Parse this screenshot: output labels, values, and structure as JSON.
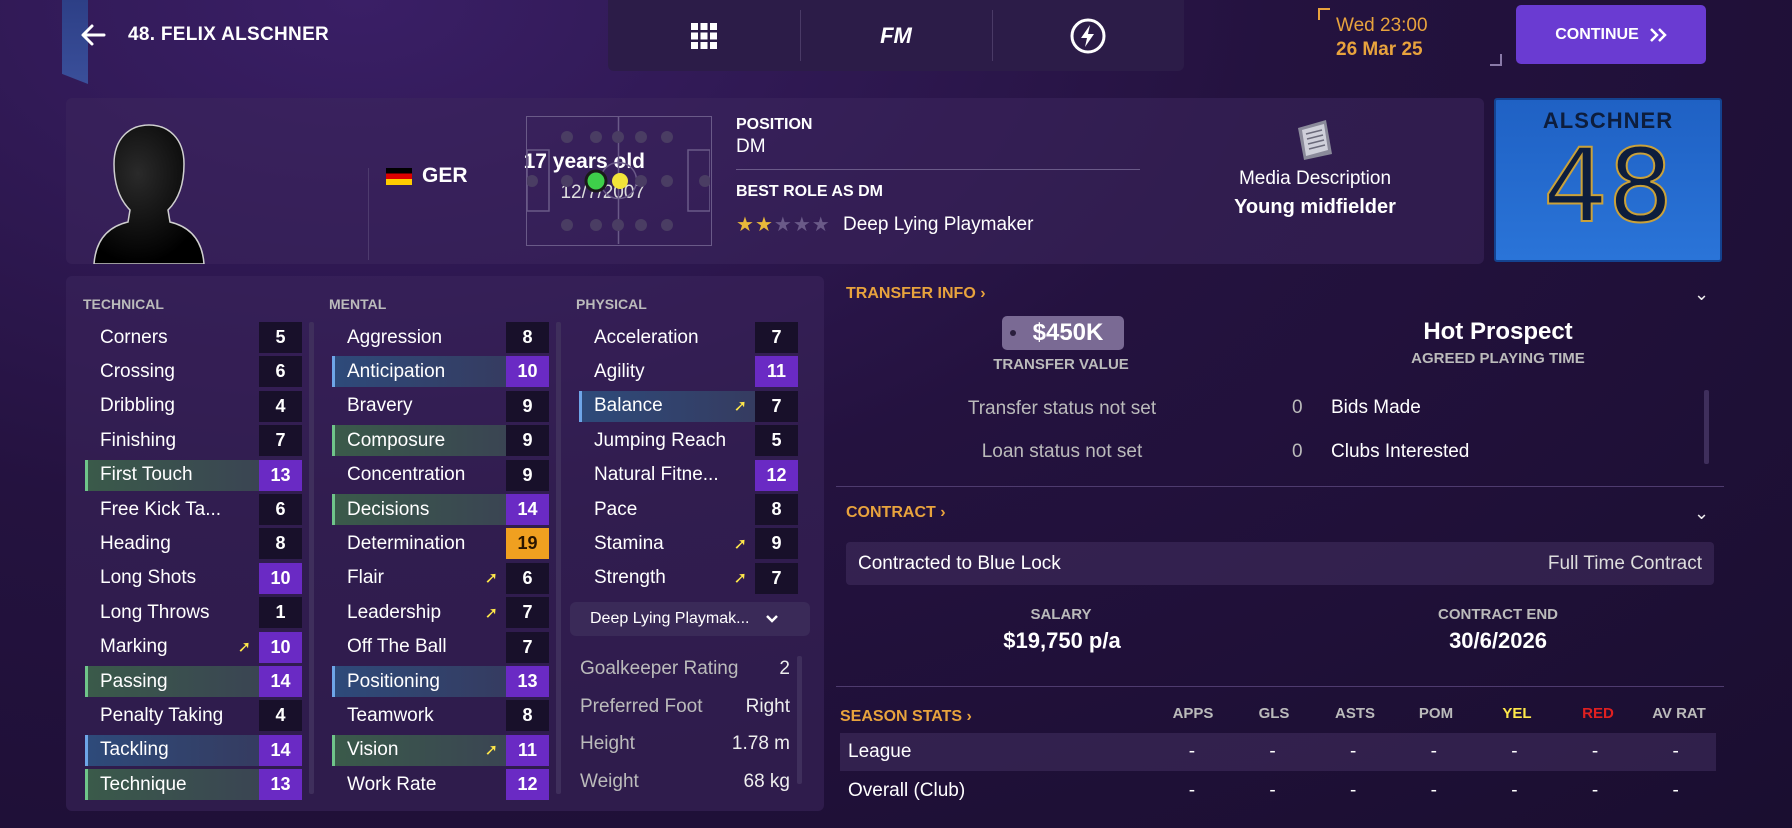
{
  "header": {
    "title": "48. FELIX ALSCHNER",
    "nav_fm": "FM",
    "date_line1": "Wed 23:00",
    "date_line2": "26 Mar 25",
    "continue_label": "CONTINUE"
  },
  "profile": {
    "age": "17 years old",
    "dob": "12/7/2007",
    "nationality": "GER",
    "position_label": "POSITION",
    "position": "DM",
    "best_role_label": "BEST ROLE AS DM",
    "best_role": "Deep Lying Playmaker",
    "role_stars": 2,
    "media_label": "Media Description",
    "media_value": "Young midfielder",
    "shirt_name": "ALSCHNER",
    "shirt_number": "48"
  },
  "attributes": {
    "technical_label": "TECHNICAL",
    "mental_label": "MENTAL",
    "physical_label": "PHYSICAL",
    "technical": [
      {
        "name": "Corners",
        "value": "5"
      },
      {
        "name": "Crossing",
        "value": "6"
      },
      {
        "name": "Dribbling",
        "value": "4"
      },
      {
        "name": "Finishing",
        "value": "7"
      },
      {
        "name": "First Touch",
        "value": "13"
      },
      {
        "name": "Free Kick Ta...",
        "value": "6"
      },
      {
        "name": "Heading",
        "value": "8"
      },
      {
        "name": "Long Shots",
        "value": "10"
      },
      {
        "name": "Long Throws",
        "value": "1"
      },
      {
        "name": "Marking",
        "value": "10"
      },
      {
        "name": "Passing",
        "value": "14"
      },
      {
        "name": "Penalty Taking",
        "value": "4"
      },
      {
        "name": "Tackling",
        "value": "14"
      },
      {
        "name": "Technique",
        "value": "13"
      }
    ],
    "mental": [
      {
        "name": "Aggression",
        "value": "8"
      },
      {
        "name": "Anticipation",
        "value": "10"
      },
      {
        "name": "Bravery",
        "value": "9"
      },
      {
        "name": "Composure",
        "value": "9"
      },
      {
        "name": "Concentration",
        "value": "9"
      },
      {
        "name": "Decisions",
        "value": "14"
      },
      {
        "name": "Determination",
        "value": "19"
      },
      {
        "name": "Flair",
        "value": "6"
      },
      {
        "name": "Leadership",
        "value": "7"
      },
      {
        "name": "Off The Ball",
        "value": "7"
      },
      {
        "name": "Positioning",
        "value": "13"
      },
      {
        "name": "Teamwork",
        "value": "8"
      },
      {
        "name": "Vision",
        "value": "11"
      },
      {
        "name": "Work Rate",
        "value": "12"
      }
    ],
    "physical": [
      {
        "name": "Acceleration",
        "value": "7"
      },
      {
        "name": "Agility",
        "value": "11"
      },
      {
        "name": "Balance",
        "value": "7"
      },
      {
        "name": "Jumping Reach",
        "value": "5"
      },
      {
        "name": "Natural Fitne...",
        "value": "12"
      },
      {
        "name": "Pace",
        "value": "8"
      },
      {
        "name": "Stamina",
        "value": "9"
      },
      {
        "name": "Strength",
        "value": "7"
      }
    ],
    "role_select": "Deep Lying Playmak...",
    "info": [
      {
        "label": "Goalkeeper Rating",
        "value": "2"
      },
      {
        "label": "Preferred Foot",
        "value": "Right"
      },
      {
        "label": "Height",
        "value": "1.78 m"
      },
      {
        "label": "Weight",
        "value": "68 kg"
      }
    ]
  },
  "transfer": {
    "heading": "TRANSFER INFO",
    "value": "$450K",
    "value_label": "TRANSFER VALUE",
    "playing_time": "Hot Prospect",
    "playing_time_label": "AGREED PLAYING TIME",
    "transfer_status": "Transfer status not set",
    "loan_status": "Loan status not set",
    "bids_count": "0",
    "bids_label": "Bids Made",
    "clubs_count": "0",
    "clubs_label": "Clubs Interested"
  },
  "contract": {
    "heading": "CONTRACT",
    "club": "Contracted to Blue Lock",
    "type": "Full Time Contract",
    "salary_label": "SALARY",
    "salary": "$19,750 p/a",
    "end_label": "CONTRACT END",
    "end": "30/6/2026"
  },
  "season": {
    "heading": "SEASON STATS",
    "columns": [
      "APPS",
      "GLS",
      "ASTS",
      "POM",
      "YEL",
      "RED",
      "AV RAT"
    ],
    "rows": [
      {
        "label": "League",
        "values": [
          "-",
          "-",
          "-",
          "-",
          "-",
          "-",
          "-"
        ]
      },
      {
        "label": "Overall (Club)",
        "values": [
          "-",
          "-",
          "-",
          "-",
          "-",
          "-",
          "-"
        ]
      }
    ]
  },
  "colors": {
    "accent": "#e8a33d",
    "continue": "#6a3bd2",
    "stat_purple": "#6a2ac4",
    "stat_orange": "#f0a020",
    "yellow": "#ffe84a",
    "red": "#e02020"
  }
}
